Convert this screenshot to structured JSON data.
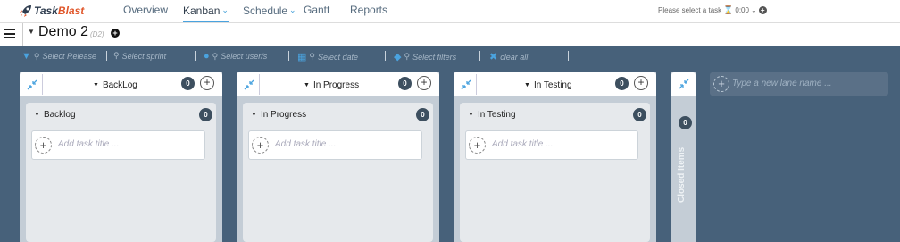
{
  "app": {
    "logo_part1": "Task",
    "logo_part2": "Blast"
  },
  "nav": {
    "tabs": [
      {
        "label": "Overview"
      },
      {
        "label": "Kanban",
        "active": true,
        "has_dropdown": true
      },
      {
        "label": "Schedule",
        "has_dropdown": true
      },
      {
        "label": "Gantt"
      },
      {
        "label": "Reports"
      }
    ],
    "task_select_label": "Please select a task",
    "timer": "0:00"
  },
  "project": {
    "name": "Demo 2",
    "id": "(D2)"
  },
  "filters": {
    "release": "Select Release",
    "sprint": "Select sprint",
    "users": "Select user/s",
    "date": "Select date",
    "filters": "Select filters",
    "clear": "clear all"
  },
  "lanes": [
    {
      "title": "BackLog",
      "count": "0",
      "sub": {
        "title": "Backlog",
        "count": "0",
        "placeholder": "Add task title ..."
      }
    },
    {
      "title": "In Progress",
      "count": "0",
      "sub": {
        "title": "In Progress",
        "count": "0",
        "placeholder": "Add task title ..."
      }
    },
    {
      "title": "In Testing",
      "count": "0",
      "sub": {
        "title": "In Testing",
        "count": "0",
        "placeholder": "Add task title ..."
      }
    }
  ],
  "closed": {
    "label": "Closed Items",
    "count": "0"
  },
  "new_lane": {
    "placeholder": "Type a new lane name ..."
  },
  "colors": {
    "accent": "#4aa3df",
    "background": "#47617a",
    "brand_orange": "#e0562a",
    "badge": "#3d4f5f"
  }
}
